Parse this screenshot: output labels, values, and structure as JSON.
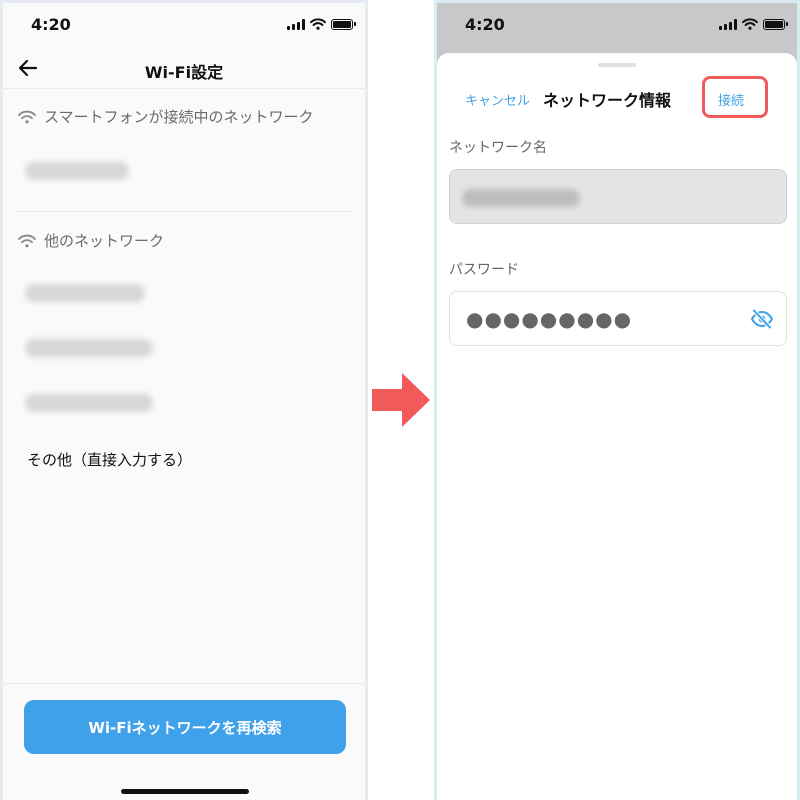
{
  "left_screen": {
    "status": {
      "time": "4:20"
    },
    "nav": {
      "title": "Wi-Fi設定"
    },
    "current_section": {
      "header": "スマートフォンが接続中のネットワーク"
    },
    "other_section": {
      "header": "他のネットワーク"
    },
    "other_manual": "その他（直接入力する）",
    "rescan_button": "Wi-Fiネットワークを再検索"
  },
  "right_screen": {
    "status": {
      "time": "4:20"
    },
    "cancel": "キャンセル",
    "title": "ネットワーク情報",
    "connect": "接続",
    "network_name_label": "ネットワーク名",
    "password_label": "パスワード",
    "password_mask": "●●●●●●●●●"
  },
  "colors": {
    "accent": "#3fa1ea",
    "highlight": "#f05a5a",
    "arrow": "#f05a5a"
  },
  "icons": [
    "back-arrow-icon",
    "wifi-icon",
    "signal-icon",
    "battery-icon",
    "eye-slash-icon",
    "arrow-right-icon"
  ]
}
